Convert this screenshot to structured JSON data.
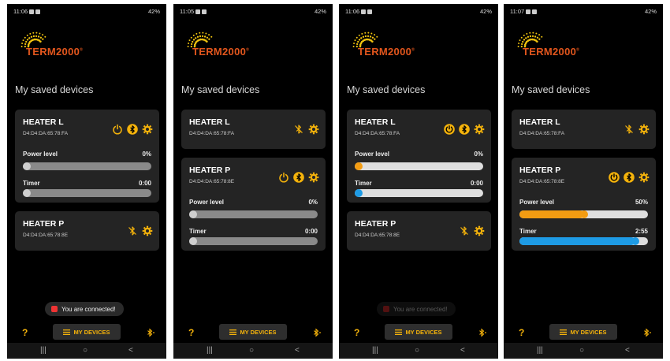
{
  "app": {
    "brand": "TERM2000",
    "brand_mark": "®"
  },
  "labels": {
    "section_title": "My saved devices",
    "power_level": "Power level",
    "timer": "Timer",
    "my_devices": "MY DEVICES",
    "help": "?",
    "connected": "You are connected!"
  },
  "nav": {
    "recents": "|||",
    "home": "○",
    "back": "<"
  },
  "status_right": "42%",
  "colors": {
    "accent": "#f5b30b",
    "power_fill": "#f39c12",
    "timer_fill": "#1e9be5",
    "brand": "#e2561d"
  },
  "screens": [
    {
      "time": "11:06",
      "devices": [
        {
          "name": "HEATER L",
          "mac": "D4:D4:DA:65:78:FA",
          "expanded": true,
          "icons": [
            "power-icon",
            "bluetooth-connected-icon",
            "settings-icon"
          ],
          "power": {
            "value": "0%",
            "fraction": 0
          },
          "timer": {
            "value": "0:00",
            "fraction": 0
          },
          "active": false
        },
        {
          "name": "HEATER P",
          "mac": "D4:D4:DA:65:78:8E",
          "expanded": false,
          "icons": [
            "bluetooth-off-icon",
            "settings-icon"
          ]
        }
      ],
      "toast": "visible"
    },
    {
      "time": "11:05",
      "devices": [
        {
          "name": "HEATER L",
          "mac": "D4:D4:DA:65:78:FA",
          "expanded": false,
          "icons": [
            "bluetooth-off-icon",
            "settings-icon"
          ]
        },
        {
          "name": "HEATER P",
          "mac": "D4:D4:DA:65:78:8E",
          "expanded": true,
          "icons": [
            "power-icon",
            "bluetooth-connected-icon",
            "settings-icon"
          ],
          "power": {
            "value": "0%",
            "fraction": 0
          },
          "timer": {
            "value": "0:00",
            "fraction": 0
          },
          "active": false
        }
      ],
      "toast": "hidden"
    },
    {
      "time": "11:06",
      "devices": [
        {
          "name": "HEATER L",
          "mac": "D4:D4:DA:65:78:FA",
          "expanded": true,
          "icons": [
            "power-on-icon",
            "bluetooth-connected-icon",
            "settings-icon"
          ],
          "power": {
            "value": "0%",
            "fraction": 0
          },
          "timer": {
            "value": "0:00",
            "fraction": 0
          },
          "active": true
        },
        {
          "name": "HEATER P",
          "mac": "D4:D4:DA:65:78:8E",
          "expanded": false,
          "icons": [
            "bluetooth-off-icon",
            "settings-icon"
          ]
        }
      ],
      "toast": "faded"
    },
    {
      "time": "11:07",
      "devices": [
        {
          "name": "HEATER L",
          "mac": "D4:D4:DA:65:78:FA",
          "expanded": false,
          "icons": [
            "bluetooth-off-icon",
            "settings-icon"
          ]
        },
        {
          "name": "HEATER P",
          "mac": "D4:D4:DA:65:78:8E",
          "expanded": true,
          "icons": [
            "power-on-icon",
            "bluetooth-connected-icon",
            "settings-icon"
          ],
          "power": {
            "value": "50%",
            "fraction": 0.5
          },
          "timer": {
            "value": "2:55",
            "fraction": 0.9
          },
          "active": true
        }
      ],
      "toast": "hidden"
    }
  ]
}
